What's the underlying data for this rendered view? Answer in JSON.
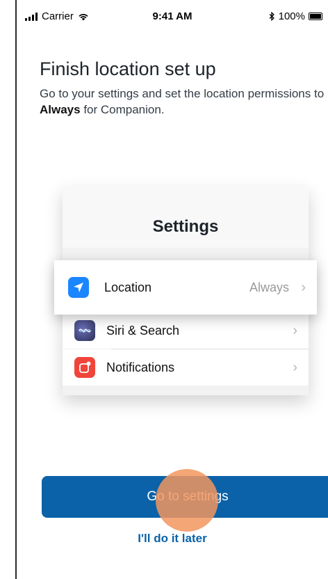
{
  "status_bar": {
    "carrier": "Carrier",
    "time": "9:41 AM",
    "battery": "100%",
    "icons": [
      "signal-icon",
      "wifi-icon",
      "bluetooth-icon",
      "battery-icon"
    ]
  },
  "screen": {
    "title": "Finish location set up",
    "subtitle_prefix": "Go to your settings and set the location permissions to ",
    "subtitle_bold": "Always",
    "subtitle_suffix": " for Companion."
  },
  "illustration": {
    "header": "Settings",
    "rows": [
      {
        "label": "Location",
        "value": "Always",
        "icon": "location-arrow-icon",
        "chevron": "›"
      },
      {
        "label": "Siri & Search",
        "icon": "siri-icon",
        "chevron": "›"
      },
      {
        "label": "Notifications",
        "icon": "notifications-icon",
        "chevron": "›"
      }
    ]
  },
  "actions": {
    "primary": "Go to settings",
    "secondary": "I'll do it later"
  },
  "colors": {
    "primary": "#0b62a8",
    "touch_indicator": "#f2965f",
    "location_icon": "#1a86ff",
    "notifications_icon": "#f0453a"
  }
}
